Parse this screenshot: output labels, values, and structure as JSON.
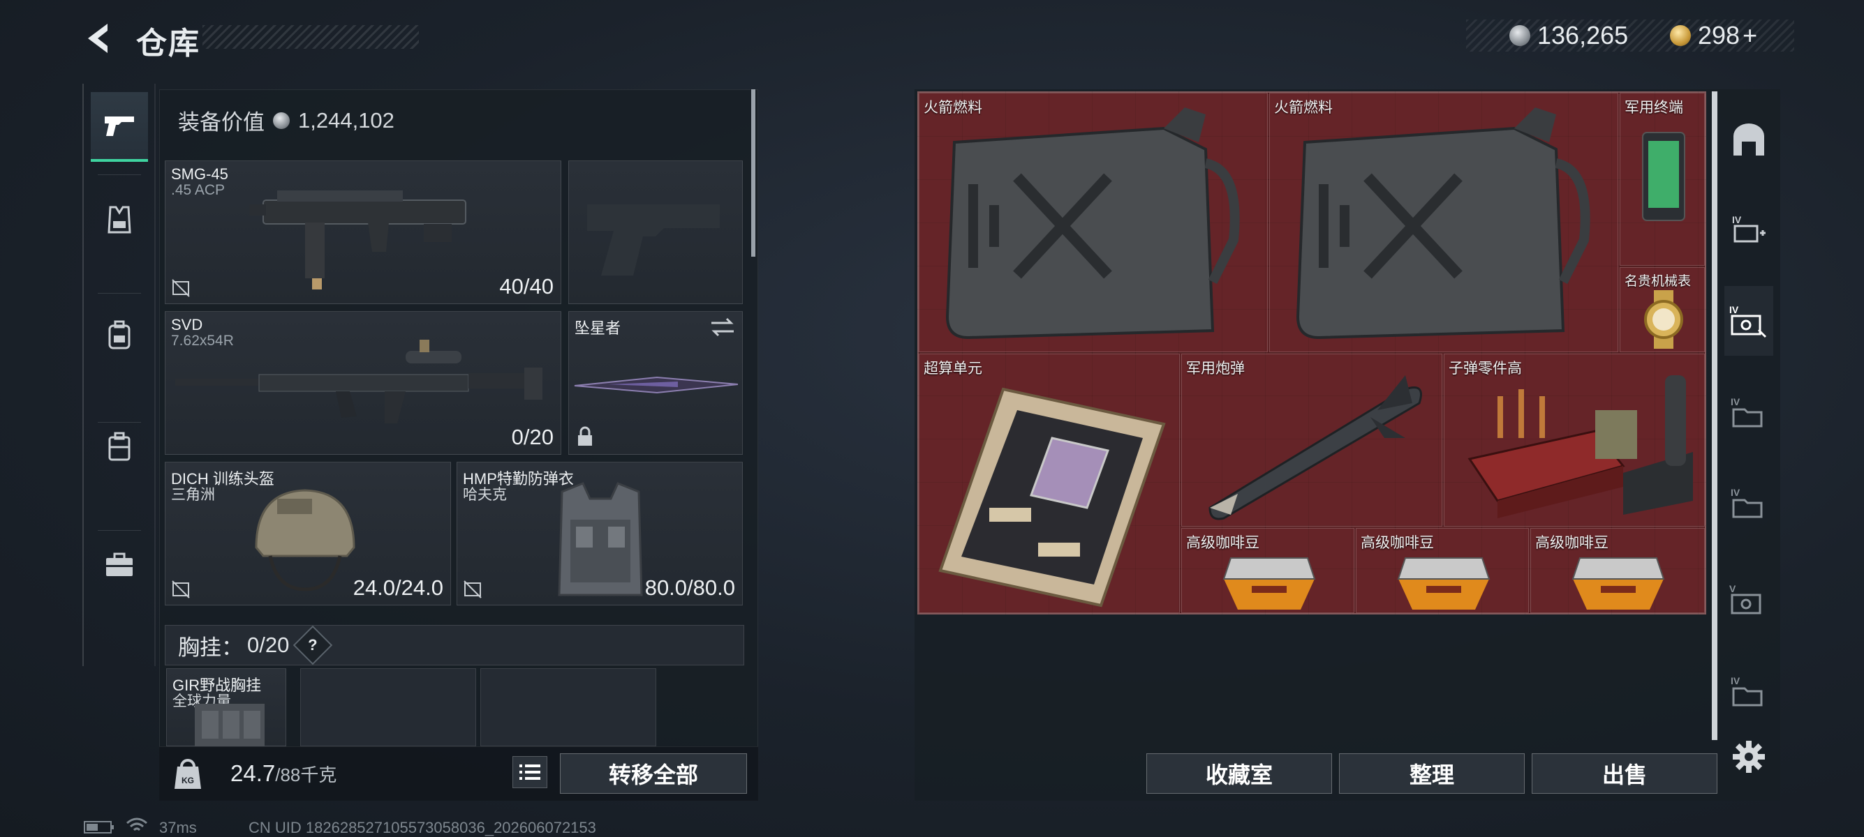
{
  "header": {
    "title": "仓库"
  },
  "currency": {
    "silver": "136,265",
    "gold": "298",
    "plus": "+"
  },
  "loadout": {
    "equipment_value_label": "装备价值",
    "equipment_value": "1,244,102",
    "primary": {
      "name": "SMG-45",
      "ammo": ".45 ACP",
      "count": "40/40"
    },
    "secondary": {
      "name": "SVD",
      "ammo": "7.62x54R",
      "count": "0/20"
    },
    "melee": {
      "name": "坠星者"
    },
    "helmet": {
      "name": "DICH 训练头盔",
      "brand": "三角洲",
      "durability": "24.0/24.0"
    },
    "armor": {
      "name": "HMP特勤防弹衣",
      "brand": "哈夫克",
      "durability": "80.0/80.0"
    },
    "chest_rig": {
      "label": "胸挂：",
      "count": "0/20",
      "help": "?",
      "item_name": "GIR野战胸挂",
      "item_brand": "全球力量"
    },
    "weight_value": "24.7",
    "weight_max": "/88千克",
    "transfer_all": "转移全部"
  },
  "storage": {
    "items": [
      {
        "name": "火箭燃料"
      },
      {
        "name": "火箭燃料"
      },
      {
        "name": "军用终端"
      },
      {
        "name": "名贵机械表"
      },
      {
        "name": "超算单元"
      },
      {
        "name": "军用炮弹"
      },
      {
        "name": "子弹零件高"
      },
      {
        "name": "高级咖啡豆"
      },
      {
        "name": "高级咖啡豆"
      },
      {
        "name": "高级咖啡豆"
      }
    ],
    "collection_room": "收藏室",
    "organize": "整理",
    "sell": "出售"
  },
  "status_bar": {
    "ping": "37ms",
    "uid": "CN UID 18262852710557305803​6_202606072153"
  },
  "colors": {
    "accent": "#3fd4a0",
    "grid_bg": "#5b2326"
  }
}
